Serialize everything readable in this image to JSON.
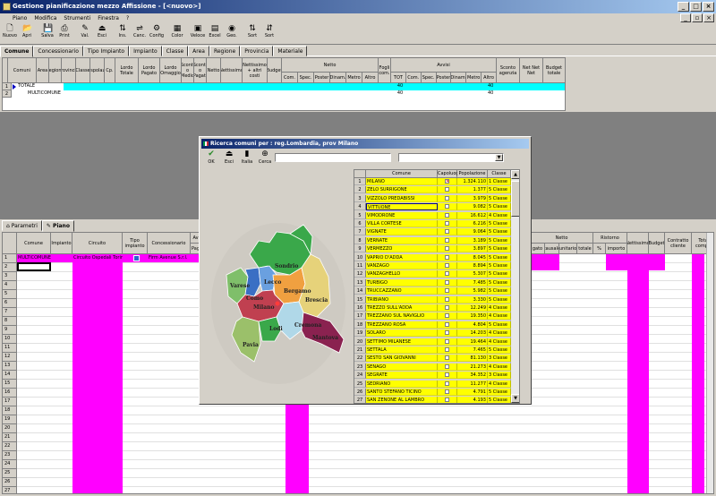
{
  "window": {
    "title": "Gestione pianificazione mezzo Affissione - [<nuovo>]"
  },
  "menu": [
    "Piano",
    "Modifica",
    "Strumenti",
    "Finestra",
    "?"
  ],
  "toolbar": [
    {
      "label": "Nuovo",
      "icon": "new-doc-icon",
      "glyph": "🗋"
    },
    {
      "label": "Apri",
      "icon": "open-folder-icon",
      "glyph": "📂"
    },
    {
      "label": "Salva",
      "icon": "save-icon",
      "glyph": "💾"
    },
    {
      "label": "Print",
      "icon": "print-icon",
      "glyph": "⎙"
    },
    {
      "label": "Val.",
      "icon": "pencil-icon",
      "glyph": "✎"
    },
    {
      "label": "Esci",
      "icon": "exit-icon",
      "glyph": "⏏"
    },
    {
      "label": "Ins.",
      "icon": "insert-icon",
      "glyph": "⇅"
    },
    {
      "label": "Canc.",
      "icon": "delete-icon",
      "glyph": "⇌"
    },
    {
      "label": "Config",
      "icon": "config-icon",
      "glyph": "⚙"
    },
    {
      "label": "Color",
      "icon": "color-icon",
      "glyph": "▦"
    },
    {
      "label": "Veloce",
      "icon": "fast-icon",
      "glyph": "▣"
    },
    {
      "label": "Excel",
      "icon": "excel-icon",
      "glyph": "▤"
    },
    {
      "label": "Geo.",
      "icon": "globe-icon",
      "glyph": "◉"
    },
    {
      "label": "Sort",
      "icon": "sort-asc-icon",
      "glyph": "⇅"
    },
    {
      "label": "Sort",
      "icon": "sort-desc-icon",
      "glyph": "⇵"
    }
  ],
  "tabs_top": [
    "Comune",
    "Concessionario",
    "Tipo Impianto",
    "Impianto",
    "Classe",
    "Area",
    "Regione",
    "Provincia",
    "Materiale"
  ],
  "grid1": {
    "headers": [
      "Comuni",
      "Area",
      "Regione",
      "Provincia",
      "Classe",
      "Pspolaz.",
      "Cp.",
      "Lordo Totale",
      "Lordo Pagato",
      "Lordo Omaggio",
      "Sconti o Medio",
      "Sconti o Pagati",
      "Netto",
      "Nettissimo",
      "Nettissimo + altri costi",
      "Budget",
      "Netto",
      "Fogli com.",
      "Avvisi",
      "Sconto agenzia",
      "Net Net Net",
      "Budget totale"
    ],
    "netto_sub": [
      "Com.",
      "Spec.",
      "Poster",
      "Dinam.",
      "Metro",
      "Altro"
    ],
    "avvisi_sub": [
      "TOT",
      "Com.",
      "Spec.",
      "Poster",
      "Dinam.",
      "Metro",
      "Altro"
    ],
    "rows": [
      {
        "n": "1",
        "name": "TOTALE",
        "tot": "40",
        "altro": "40"
      },
      {
        "n": "2",
        "name": "MULTICOMUNE",
        "tot": "40",
        "altro": "40"
      }
    ]
  },
  "tabs_bottom": [
    "Parametri",
    "Piano"
  ],
  "grid2": {
    "headers": [
      "Comune",
      "Impianto",
      "Circuito",
      "Tipo impianto",
      "Concessionario",
      "Av",
      "Pag",
      "gato",
      "causale",
      "unitario",
      "totale",
      "%",
      "importo",
      "Nettissimo",
      "Budget",
      "Contratto cliente",
      "Tota compe"
    ],
    "netto_label": "Netto",
    "ristorno_label": "Ristorno",
    "row1": {
      "comune": "MULTICOMUNE",
      "circuito": "Circuito Ospedali Torinese",
      "concessionario": "Firm Avenue S.r.l."
    },
    "row_count": 27
  },
  "dialog": {
    "title": "Ricerca comuni per : reg.Lombardia, prov Milano",
    "buttons": [
      {
        "label": "OK",
        "icon": "check-icon",
        "glyph": "✔"
      },
      {
        "label": "Esci",
        "icon": "exit-icon",
        "glyph": "⏏"
      },
      {
        "label": "Italia",
        "icon": "italy-icon",
        "glyph": "▮"
      },
      {
        "label": "Cerca",
        "icon": "binoculars-icon",
        "glyph": "⊕"
      }
    ],
    "map_labels": [
      "Sondrio",
      "Varese",
      "Como",
      "Lecco",
      "Bergamo",
      "Brescia",
      "Milano",
      "Lodi",
      "Cremona",
      "Pavia",
      "Mantova"
    ],
    "headers": [
      "Comune",
      "Capoluogo",
      "Popolazione",
      "Classe"
    ],
    "rows": [
      {
        "n": "1",
        "comune": "MILANO",
        "cap": true,
        "pop": "1.324.110",
        "classe": "1 Classe"
      },
      {
        "n": "2",
        "comune": "ZELO SURRIGONE",
        "cap": false,
        "pop": "1.377",
        "classe": "5 Classe"
      },
      {
        "n": "3",
        "comune": "VIZZOLO PREDABISSI",
        "cap": false,
        "pop": "3.979",
        "classe": "5 Classe"
      },
      {
        "n": "4",
        "comune": "VITTUONE",
        "cap": false,
        "pop": "9.082",
        "classe": "5 Classe"
      },
      {
        "n": "5",
        "comune": "VIMODRONE",
        "cap": false,
        "pop": "16.612",
        "classe": "4 Classe"
      },
      {
        "n": "6",
        "comune": "VILLA CORTESE",
        "cap": false,
        "pop": "6.216",
        "classe": "5 Classe"
      },
      {
        "n": "7",
        "comune": "VIGNATE",
        "cap": false,
        "pop": "9.064",
        "classe": "5 Classe"
      },
      {
        "n": "8",
        "comune": "VERNATE",
        "cap": false,
        "pop": "3.189",
        "classe": "5 Classe"
      },
      {
        "n": "9",
        "comune": "VERMEZZO",
        "cap": false,
        "pop": "3.897",
        "classe": "5 Classe"
      },
      {
        "n": "10",
        "comune": "VAPRIO D'ADDA",
        "cap": false,
        "pop": "8.045",
        "classe": "5 Classe"
      },
      {
        "n": "11",
        "comune": "VANZAGO",
        "cap": false,
        "pop": "8.894",
        "classe": "5 Classe"
      },
      {
        "n": "12",
        "comune": "VANZAGHELLO",
        "cap": false,
        "pop": "5.307",
        "classe": "5 Classe"
      },
      {
        "n": "13",
        "comune": "TURBIGO",
        "cap": false,
        "pop": "7.485",
        "classe": "5 Classe"
      },
      {
        "n": "14",
        "comune": "TRUCCAZZANO",
        "cap": false,
        "pop": "5.982",
        "classe": "5 Classe"
      },
      {
        "n": "15",
        "comune": "TRIBIANO",
        "cap": false,
        "pop": "3.330",
        "classe": "5 Classe"
      },
      {
        "n": "16",
        "comune": "TREZZO SULL'ADDA",
        "cap": false,
        "pop": "12.249",
        "classe": "4 Classe"
      },
      {
        "n": "17",
        "comune": "TREZZANO SUL NAVIGLIO",
        "cap": false,
        "pop": "19.350",
        "classe": "4 Classe"
      },
      {
        "n": "18",
        "comune": "TREZZANO ROSA",
        "cap": false,
        "pop": "4.804",
        "classe": "5 Classe"
      },
      {
        "n": "19",
        "comune": "SOLARO",
        "cap": false,
        "pop": "14.203",
        "classe": "4 Classe"
      },
      {
        "n": "20",
        "comune": "SETTIMO MILANESE",
        "cap": false,
        "pop": "19.464",
        "classe": "4 Classe"
      },
      {
        "n": "21",
        "comune": "SETTALA",
        "cap": false,
        "pop": "7.465",
        "classe": "5 Classe"
      },
      {
        "n": "22",
        "comune": "SESTO SAN GIOVANNI",
        "cap": false,
        "pop": "81.130",
        "classe": "3 Classe"
      },
      {
        "n": "23",
        "comune": "SENAGO",
        "cap": false,
        "pop": "21.273",
        "classe": "4 Classe"
      },
      {
        "n": "24",
        "comune": "SEGRATE",
        "cap": false,
        "pop": "34.352",
        "classe": "3 Classe"
      },
      {
        "n": "25",
        "comune": "SEDRIANO",
        "cap": false,
        "pop": "11.277",
        "classe": "4 Classe"
      },
      {
        "n": "26",
        "comune": "SANTO STEFANO TICINO",
        "cap": false,
        "pop": "4.791",
        "classe": "5 Classe"
      },
      {
        "n": "27",
        "comune": "SAN ZENONE AL LAMBRO",
        "cap": false,
        "pop": "4.193",
        "classe": "5 Classe"
      }
    ]
  }
}
